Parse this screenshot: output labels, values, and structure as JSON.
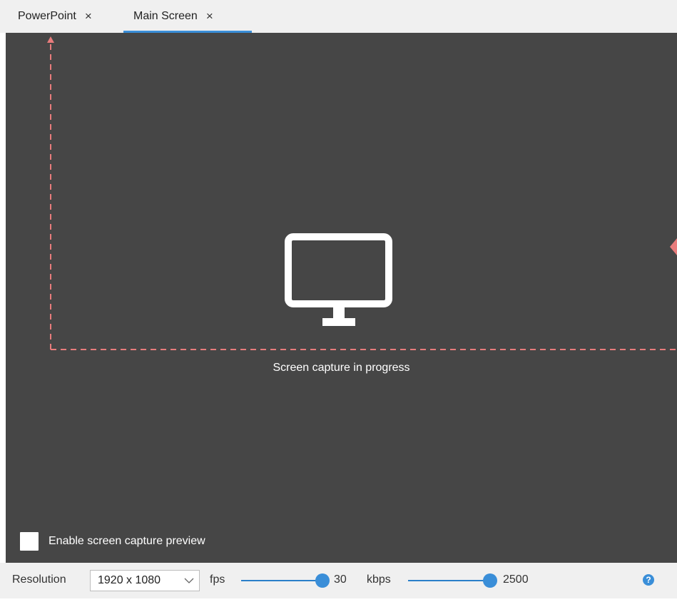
{
  "tabs": [
    {
      "label": "PowerPoint",
      "close_glyph": "×",
      "active": false
    },
    {
      "label": "Main Screen",
      "close_glyph": "×",
      "active": true
    }
  ],
  "stage": {
    "icon": "monitor-icon",
    "message": "Screen capture in progress",
    "preview_checkbox": {
      "label": "Enable screen capture preview",
      "checked": false
    }
  },
  "toolbar": {
    "resolution_label": "Resolution",
    "resolution_value": "1920 x 1080",
    "fps_label": "fps",
    "fps_value": "30",
    "fps_level": 1.0,
    "kbps_label": "kbps",
    "kbps_value": "2500",
    "kbps_level": 1.0,
    "help_glyph": "?"
  },
  "colors": {
    "accent": "#3a8ed8",
    "stage_bg": "#464646",
    "chrome_bg": "#f0f0f0",
    "annotation": "#e87c7c"
  }
}
